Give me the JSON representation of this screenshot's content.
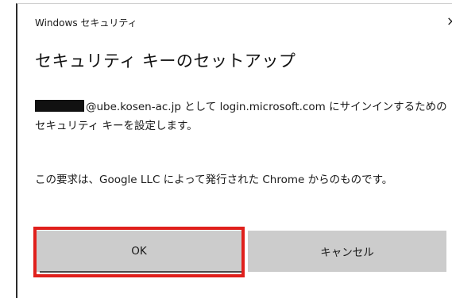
{
  "dialog": {
    "window_title": "Windows セキュリティ",
    "close_glyph": "×",
    "heading": "セキュリティ キーのセットアップ",
    "message_1_email_suffix": "@ube.kosen-ac.jp として login.microsoft.com にサインインするためのセキュリティ キーを設定します。",
    "message_2": "この要求は、Google LLC によって発行された Chrome からのものです。",
    "ok_label": "OK",
    "cancel_label": "キャンセル",
    "highlight_color": "#e0201c"
  }
}
